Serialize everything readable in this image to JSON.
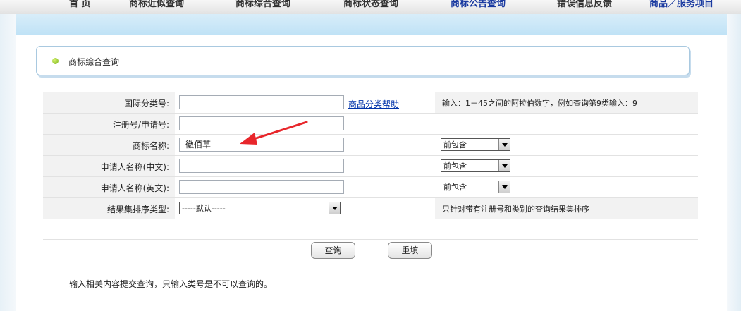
{
  "nav": {
    "items": [
      {
        "label": "首 页"
      },
      {
        "label": "商标近似查询"
      },
      {
        "label": "商标综合查询"
      },
      {
        "label": "商标状态查询"
      },
      {
        "label": "商标公告查询"
      },
      {
        "label": "错误信息反馈"
      },
      {
        "label": "商品／服务项目"
      }
    ]
  },
  "section": {
    "title": "商标综合查询"
  },
  "form": {
    "class_label": "国际分类号:",
    "class_value": "",
    "class_help": "商品分类帮助",
    "class_note": "输入：1－45之间的阿拉伯数字，例如查询第9类输入：9",
    "regno_label": "注册号/申请号:",
    "regno_value": "",
    "name_label": "商标名称:",
    "name_value": "徽佰草",
    "name_match": "前包含",
    "applicant_cn_label": "申请人名称(中文):",
    "applicant_cn_value": "",
    "applicant_cn_match": "前包含",
    "applicant_en_label": "申请人名称(英文):",
    "applicant_en_value": "",
    "applicant_en_match": "前包含",
    "sort_label": "结果集排序类型:",
    "sort_value": "-----默认-----",
    "sort_note": "只针对带有注册号和类别的查询结果集排序"
  },
  "buttons": {
    "query": "查询",
    "reset": "重填"
  },
  "hint": "输入相关内容提交查询，只输入类号是不可以查询的。",
  "colors": {
    "accent": "#1a3aa0",
    "arrow": "#e8262b",
    "dot": "#8cc21f"
  }
}
